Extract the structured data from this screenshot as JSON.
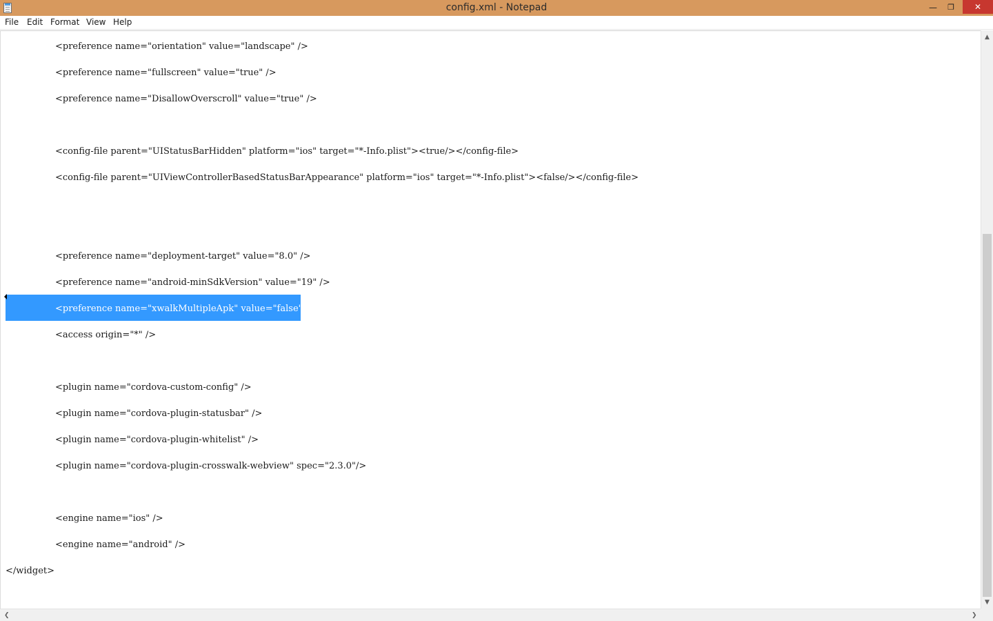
{
  "window": {
    "title": "config.xml - Notepad",
    "minimize_glyph": "—",
    "maximize_glyph": "❐",
    "close_glyph": "✕"
  },
  "menu": [
    "File",
    "Edit",
    "Format",
    "View",
    "Help"
  ],
  "editor": {
    "selected_line": 10,
    "selection_color": "#3399ff",
    "lines": [
      "        <preference name=\"orientation\" value=\"landscape\" />",
      "        <preference name=\"fullscreen\" value=\"true\" />",
      "        <preference name=\"DisallowOverscroll\" value=\"true\" />",
      "",
      "        <config-file parent=\"UIStatusBarHidden\" platform=\"ios\" target=\"*-Info.plist\"><true/></config-file>",
      "        <config-file parent=\"UIViewControllerBasedStatusBarAppearance\" platform=\"ios\" target=\"*-Info.plist\"><false/></config-file>",
      "",
      "",
      "        <preference name=\"deployment-target\" value=\"8.0\" />",
      "        <preference name=\"android-minSdkVersion\" value=\"19\" />",
      "        <preference name=\"xwalkMultipleApk\" value=\"false\" />",
      "        <access origin=\"*\" />",
      "",
      "        <plugin name=\"cordova-custom-config\" />",
      "        <plugin name=\"cordova-plugin-statusbar\" />",
      "        <plugin name=\"cordova-plugin-whitelist\" />",
      "        <plugin name=\"cordova-plugin-crosswalk-webview\" spec=\"2.3.0\"/>",
      "",
      "        <engine name=\"ios\" />",
      "        <engine name=\"android\" />",
      "</widget>"
    ]
  },
  "scrollbars": {
    "up_arrow": "▲",
    "down_arrow": "▼",
    "left_arrow": "❮",
    "right_arrow": "❯"
  },
  "colors": {
    "titlebar": "#d7995e",
    "close_button": "#c7372f"
  }
}
